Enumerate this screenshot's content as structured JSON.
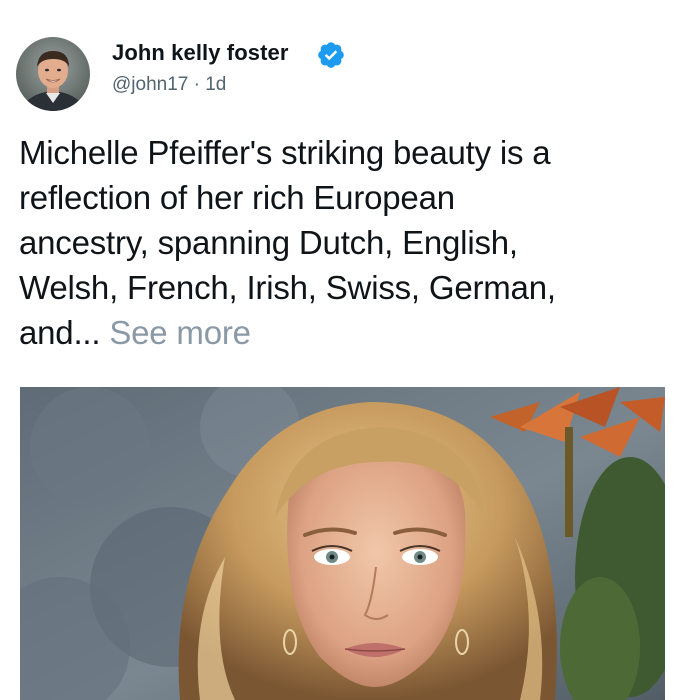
{
  "tweet": {
    "author": {
      "name": "John kelly foster",
      "handle": "@john17",
      "separator": " · ",
      "time": "1d",
      "verified_icon": "verified-badge-icon",
      "avatar_icon": "profile-avatar"
    },
    "text_lines": [
      "Michelle Pfeiffer's striking beauty is a",
      "reflection of her rich European",
      "ancestry, spanning Dutch, English,",
      "Welsh, French, Irish, Swiss, German,",
      "and..."
    ],
    "see_more": "See more",
    "media": {
      "kind": "photo"
    }
  },
  "colors": {
    "text_primary": "#0f1419",
    "text_secondary": "#536471",
    "see_more": "#8b98a5",
    "verified_blue": "#1d9bf0"
  }
}
